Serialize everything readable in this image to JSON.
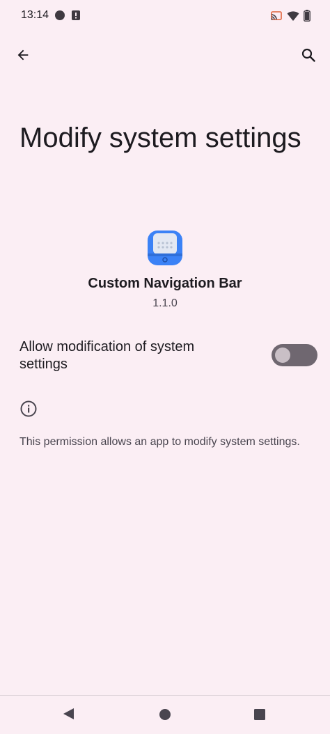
{
  "status_bar": {
    "time": "13:14",
    "left_icons": [
      "circle-notification-icon",
      "alert-notification-icon"
    ],
    "right_icons": [
      "cast-icon",
      "wifi-icon",
      "battery-icon"
    ]
  },
  "top_bar": {
    "back_icon": "arrow-back-icon",
    "search_icon": "search-icon"
  },
  "page": {
    "title": "Modify system settings"
  },
  "app": {
    "name": "Custom Navigation Bar",
    "version": "1.1.0",
    "icon": "custom-navigation-bar-app-icon",
    "icon_color": "#3B82F6"
  },
  "setting": {
    "label": "Allow modification of system settings",
    "enabled": false
  },
  "info": {
    "icon": "info-icon",
    "text": "This permission allows an app to modify system settings."
  },
  "navigation_bar": {
    "buttons": [
      "nav-back-icon",
      "nav-home-icon",
      "nav-recents-icon"
    ]
  },
  "colors": {
    "background": "#FBEEF4",
    "text_primary": "#1D1B20",
    "text_secondary": "#49454F",
    "switch_track_off": "#6F6770",
    "switch_thumb_off": "#C9BFC6"
  }
}
